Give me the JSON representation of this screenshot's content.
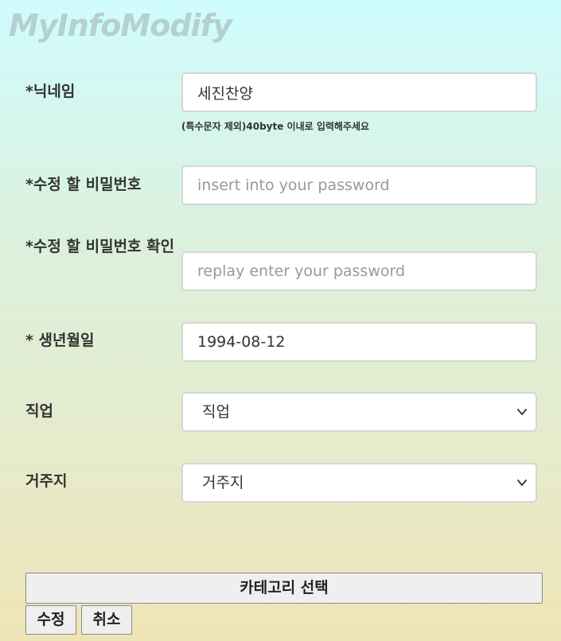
{
  "page": {
    "title": "MyInfoModify"
  },
  "form": {
    "nickname": {
      "label": "*닉네임",
      "value": "세진찬양",
      "hint": "(특수문자 제외)40byte 이내로 입력해주세요"
    },
    "new_password": {
      "label": "*수정 할 비밀번호",
      "placeholder": "insert into your password"
    },
    "confirm_password": {
      "label": "*수정 할 비밀번호 확인",
      "placeholder": "replay enter your password"
    },
    "birthdate": {
      "label": "* 생년월일",
      "value": "1994-08-12"
    },
    "job": {
      "label": "직업",
      "selected": "직업",
      "icon": "chevron-down-icon"
    },
    "residence": {
      "label": "거주지",
      "selected": "거주지",
      "icon": "chevron-down-icon"
    }
  },
  "buttons": {
    "category": "카테고리 선택",
    "modify": "수정",
    "cancel": "취소"
  }
}
